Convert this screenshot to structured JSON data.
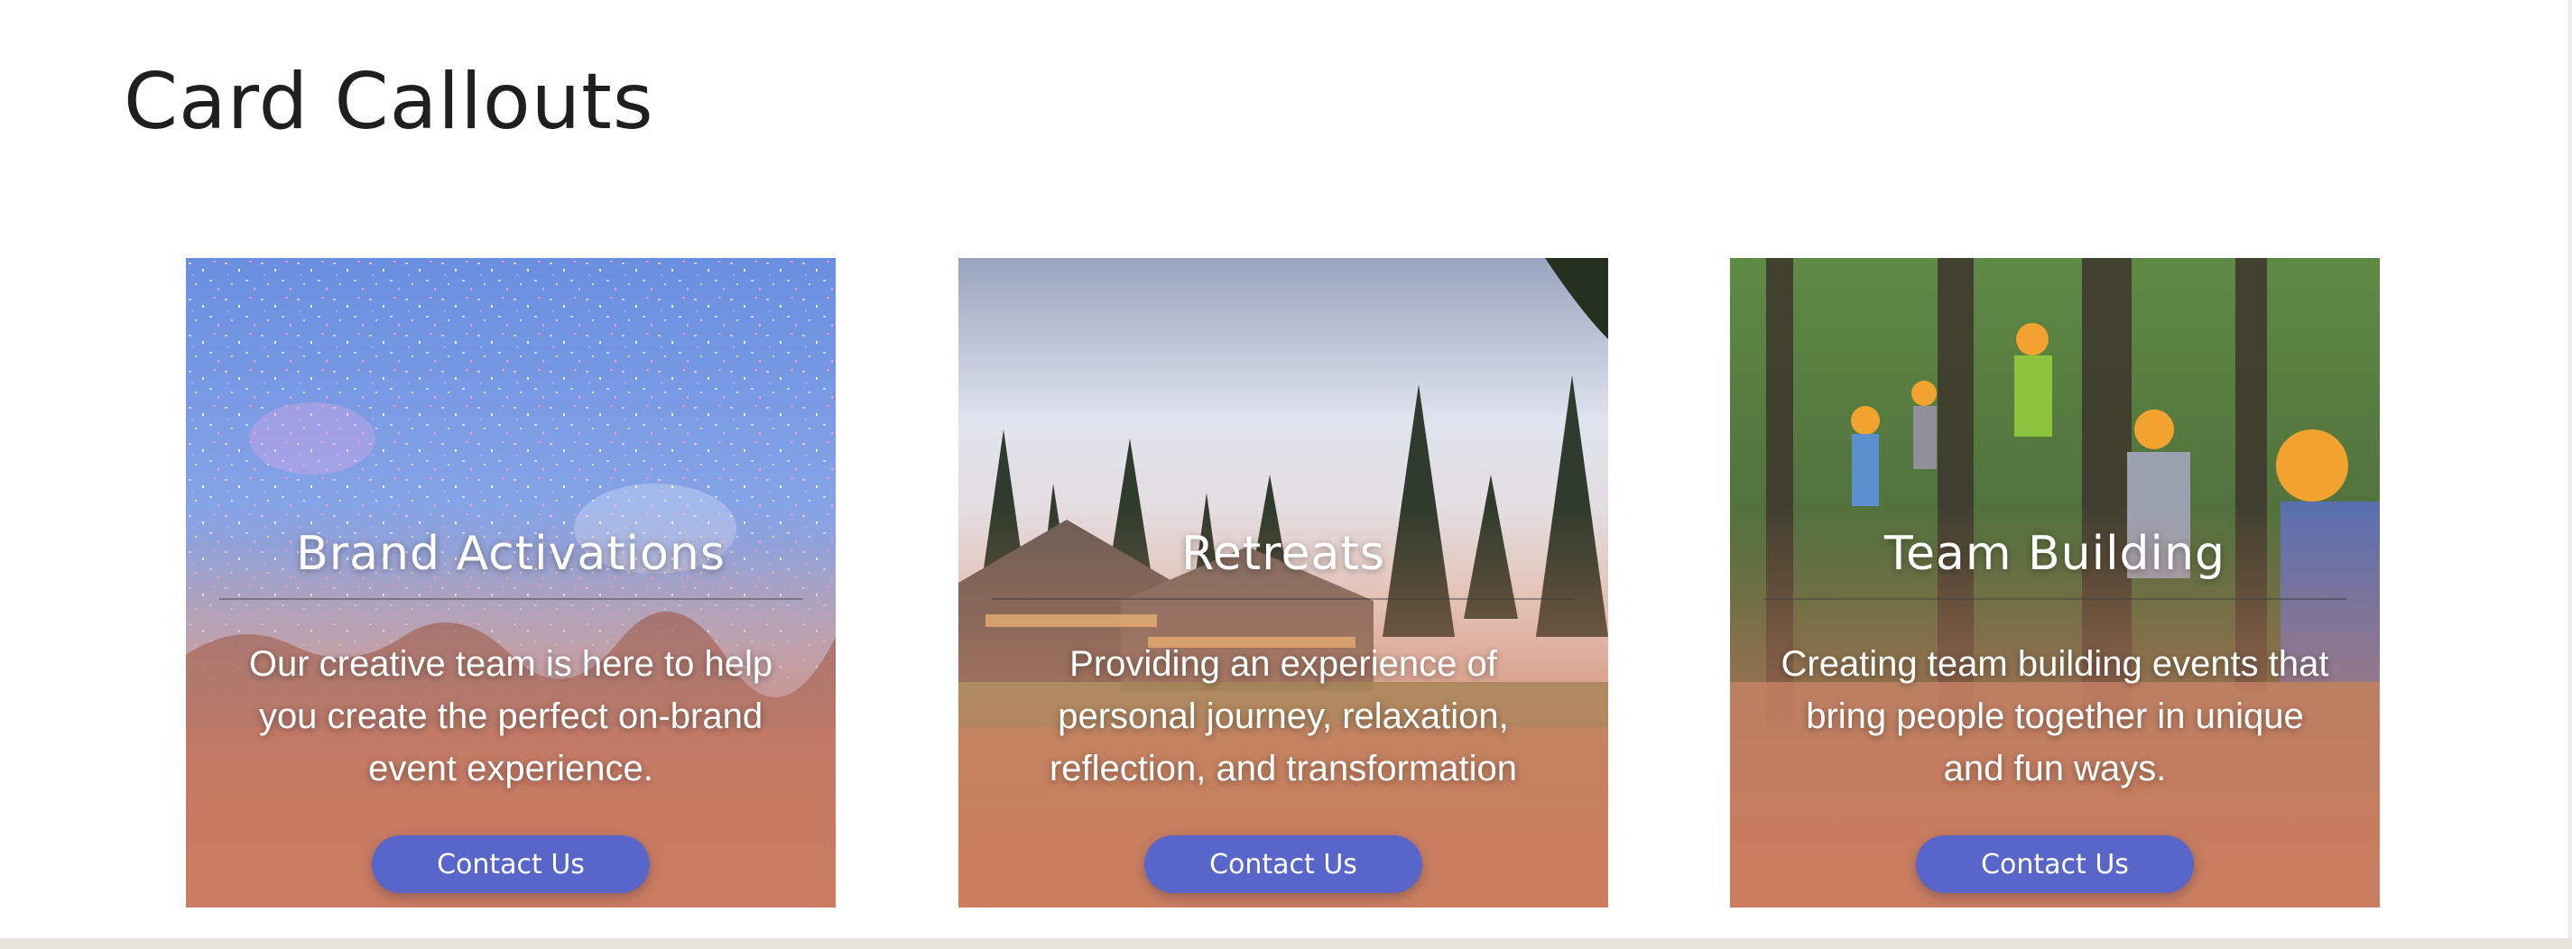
{
  "page": {
    "title": "Card Callouts"
  },
  "cards": [
    {
      "title": "Brand Activations",
      "text": "Our creative team is here to help you create the perfect on-brand event experience.",
      "button_label": "Contact Us",
      "image": "confetti-concert-photo"
    },
    {
      "title": "Retreats",
      "text": "Providing an experience of personal journey, relaxation, reflection, and transformation",
      "button_label": "Contact Us",
      "image": "forest-lodge-photo"
    },
    {
      "title": "Team Building",
      "text": "Creating team building events that bring people together in unique and fun ways.",
      "button_label": "Contact Us",
      "image": "ropes-course-photo"
    }
  ],
  "colors": {
    "button": "#5865c9",
    "overlay": "#cd7d5f",
    "title_text": "#1f1f1f"
  }
}
